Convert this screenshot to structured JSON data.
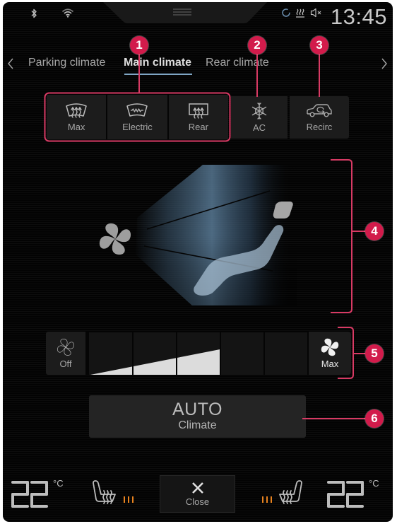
{
  "status_bar": {
    "time": "13:45",
    "icons_left": [
      "bluetooth-icon",
      "wifi-icon"
    ],
    "icons_right": [
      "sync-icon",
      "rear-defrost-status-icon",
      "mute-icon"
    ],
    "handle_icon": "drag-handle-icon"
  },
  "tabs": {
    "prev_icon": "chevron-left-icon",
    "next_icon": "chevron-right-icon",
    "items": [
      {
        "label": "Parking climate",
        "active": false
      },
      {
        "label": "Main climate",
        "active": true
      },
      {
        "label": "Rear climate",
        "active": false
      }
    ]
  },
  "defrost_buttons": [
    {
      "label": "Max",
      "icon": "max-defroster-icon"
    },
    {
      "label": "Electric",
      "icon": "heated-windscreen-icon"
    },
    {
      "label": "Rear",
      "icon": "rear-window-defroster-icon"
    }
  ],
  "ac_button": {
    "label": "AC",
    "icon": "snowflake-icon"
  },
  "recirc_button": {
    "label": "Recirc",
    "icon": "recirculation-icon"
  },
  "airflow": {
    "icon_fan": "fan-icon",
    "icon_seat": "seat-icon"
  },
  "fan": {
    "off_label": "Off",
    "max_label": "Max",
    "level": 3,
    "max_level": 5
  },
  "auto_button": {
    "title": "AUTO",
    "subtitle": "Climate"
  },
  "bottom_bar": {
    "driver_temp": "22",
    "passenger_temp": "22",
    "unit": "°C",
    "close_label": "Close",
    "close_icon": "close-icon",
    "driver_seat_heat_level": 3,
    "passenger_seat_heat_level": 3
  },
  "callouts": [
    "1",
    "2",
    "3",
    "4",
    "5",
    "6"
  ],
  "colors": {
    "callout": "#d21b4b",
    "seat_heat": "#e8821e",
    "tab_underline": "#7fa6c4",
    "text": "#a8a8a8"
  }
}
